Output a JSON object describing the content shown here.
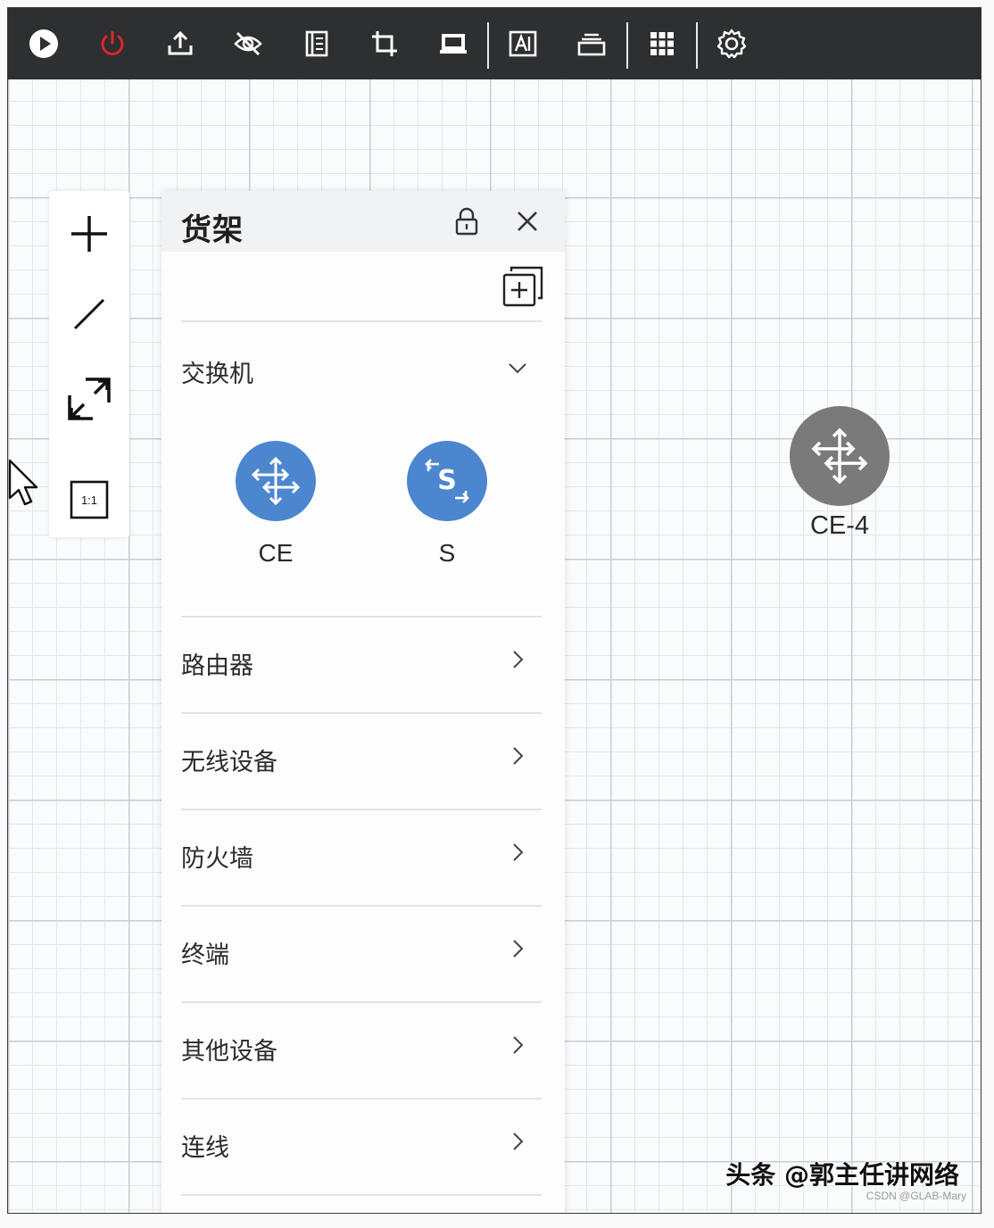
{
  "shelf": {
    "title": "货架",
    "expanded_category": {
      "label": "交换机",
      "devices": [
        {
          "label": "CE",
          "icon": "switch-arrows-icon"
        },
        {
          "label": "S",
          "icon": "switch-s-icon"
        }
      ]
    },
    "categories": [
      {
        "label": "路由器"
      },
      {
        "label": "无线设备"
      },
      {
        "label": "防火墙"
      },
      {
        "label": "终端"
      },
      {
        "label": "其他设备"
      },
      {
        "label": "连线"
      }
    ]
  },
  "left_tools": {
    "zoom_reset_label": "1:1"
  },
  "canvas": {
    "node_label": "CE-4"
  },
  "watermark": {
    "text": "头条 @郭主任讲网络",
    "sub": "CSDN @GLAB-Mary"
  },
  "colors": {
    "toolbar_bg": "#2e2f31",
    "device_blue": "#4c86cf",
    "node_gray": "#7a7a7a",
    "power_red": "#e0262b"
  }
}
